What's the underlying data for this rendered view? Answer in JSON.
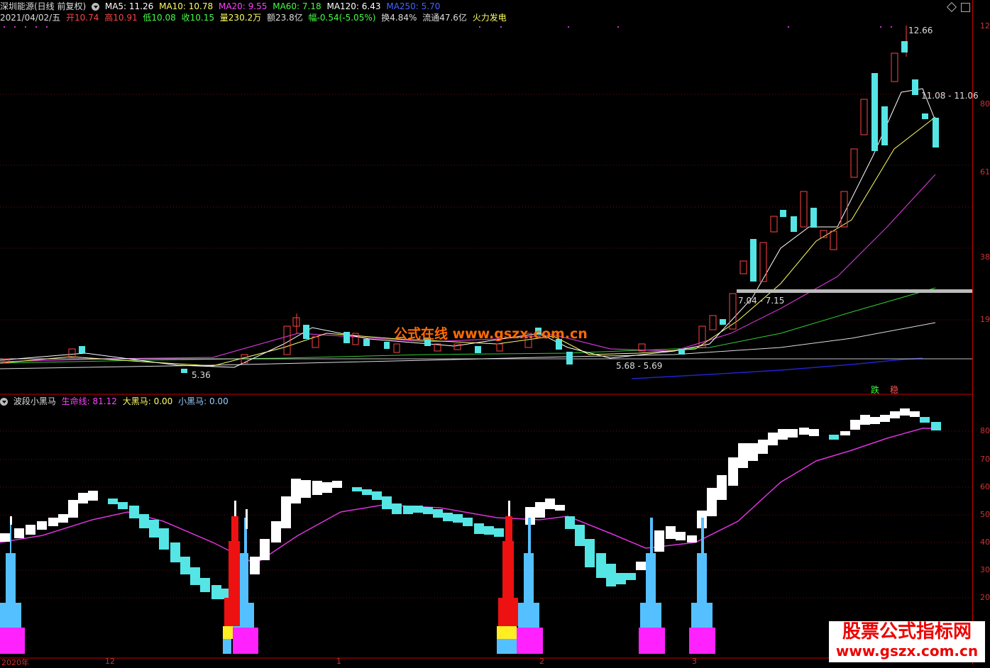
{
  "header": {
    "stock": "深圳能源(日线 前复权)",
    "ma": [
      {
        "label": "MA5: 11.26",
        "color": "#ffffff"
      },
      {
        "label": "MA10: 10.78",
        "color": "#ffff66"
      },
      {
        "label": "MA20: 9.55",
        "color": "#ff44ff"
      },
      {
        "label": "MA60: 7.18",
        "color": "#44ff44"
      },
      {
        "label": "MA120: 6.43",
        "color": "#ffffff"
      },
      {
        "label": "MA250: 5.70",
        "color": "#4466ff"
      }
    ]
  },
  "info": {
    "date": "2021/04/02/五",
    "open": "开10.74",
    "high": "高10.91",
    "low": "低10.08",
    "close": "收10.15",
    "vol": "量230.2万",
    "amount": "额23.8亿",
    "change": "幅-0.54(-5.05%)",
    "turnover": "换4.84%",
    "float": "流通47.6亿",
    "sector": "火力发电"
  },
  "annotations": {
    "high": "12.66",
    "range1": "11.08 - 11.06",
    "range2": "7.04 - 7.15",
    "range3": "5.68 - 5.69",
    "low": "5.36",
    "die": "跌",
    "wen": "稳"
  },
  "watermark": {
    "center": "公式在线  www.gszx.com.cn",
    "corner_title": "股票公式指标网",
    "corner_url": "www.gszx.com.cn"
  },
  "price_axis": [
    "12",
    "80",
    "61",
    "38",
    "19"
  ],
  "indicator": {
    "name": "波段小黑马",
    "life": "生命线: 81.12",
    "big": "大黑马: 0.00",
    "small": "小黑马: 0.00"
  },
  "ind_axis": [
    "80",
    "70",
    "60",
    "50",
    "40",
    "30",
    "20"
  ],
  "date_axis": [
    "2020年",
    "12",
    "1",
    "2",
    "3"
  ]
}
